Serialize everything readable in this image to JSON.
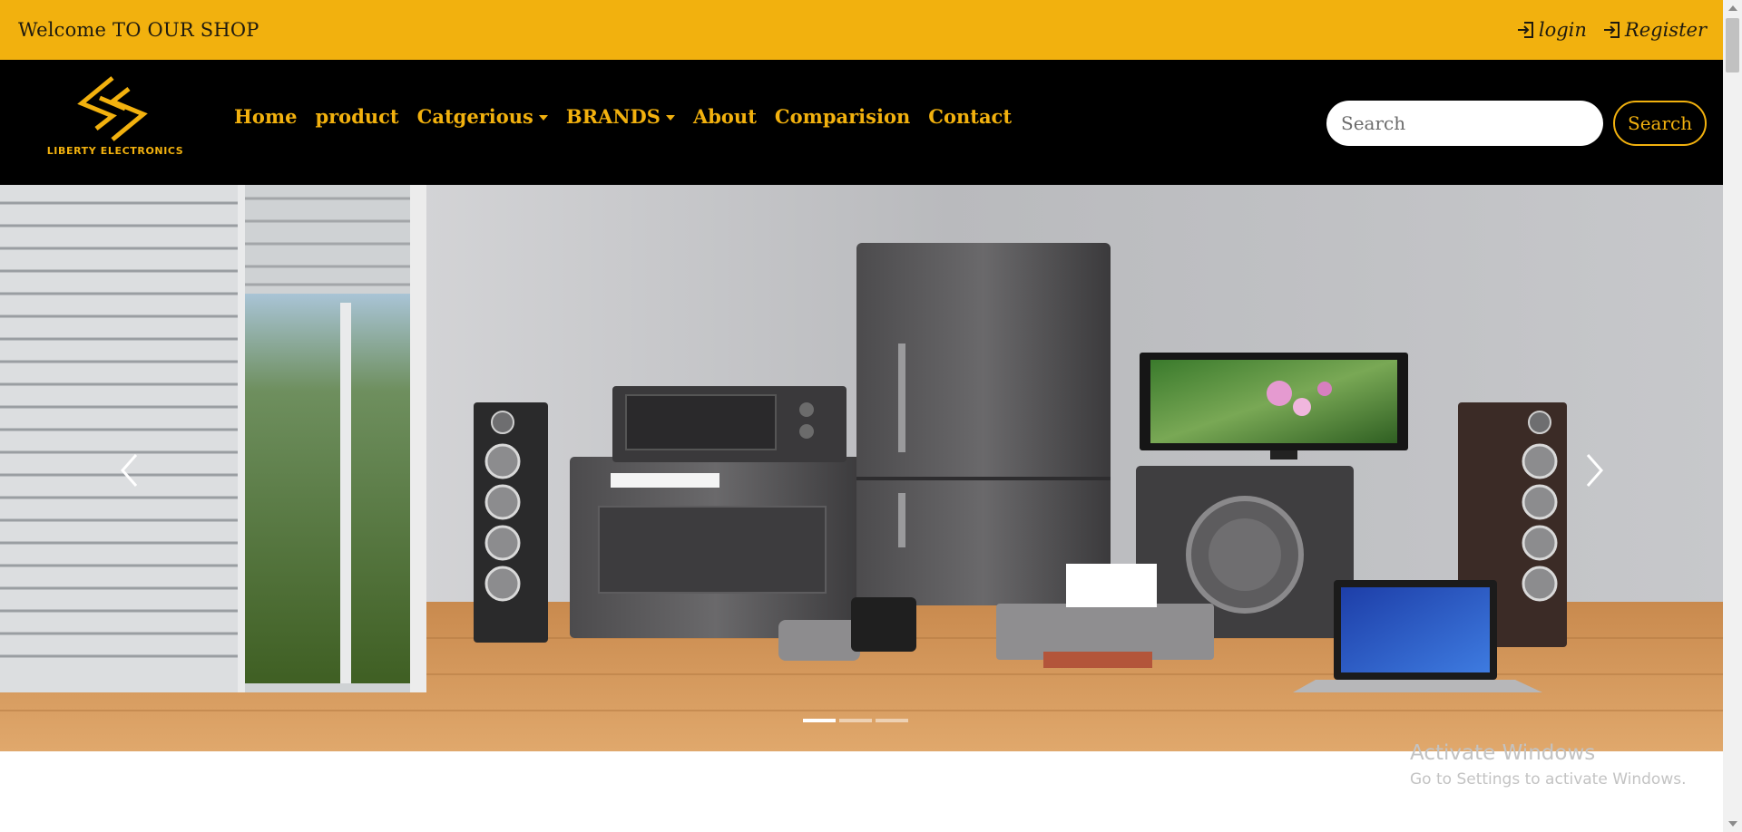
{
  "topbar": {
    "welcome": "Welcome TO OUR SHOP",
    "login_label": "login",
    "register_label": "Register",
    "background_color": "#f2b10e"
  },
  "navbar": {
    "logo_text": "LIBERTY ELECTRONICS",
    "links": [
      {
        "label": "Home"
      },
      {
        "label": "product"
      },
      {
        "label": "Catgerious",
        "dropdown": true
      },
      {
        "label": "BRANDS",
        "dropdown": true
      },
      {
        "label": "About"
      },
      {
        "label": "Comparision"
      },
      {
        "label": "Contact"
      }
    ],
    "accent_color": "#f2b10e",
    "background_color": "#000000"
  },
  "search": {
    "placeholder": "Search",
    "button_label": "Search"
  },
  "carousel": {
    "slide_count": 3,
    "active_slide": 1,
    "prev_icon": "chevron-left-icon",
    "next_icon": "chevron-right-icon"
  },
  "watermark": {
    "title": "Activate Windows",
    "subtitle": "Go to Settings to activate Windows."
  }
}
